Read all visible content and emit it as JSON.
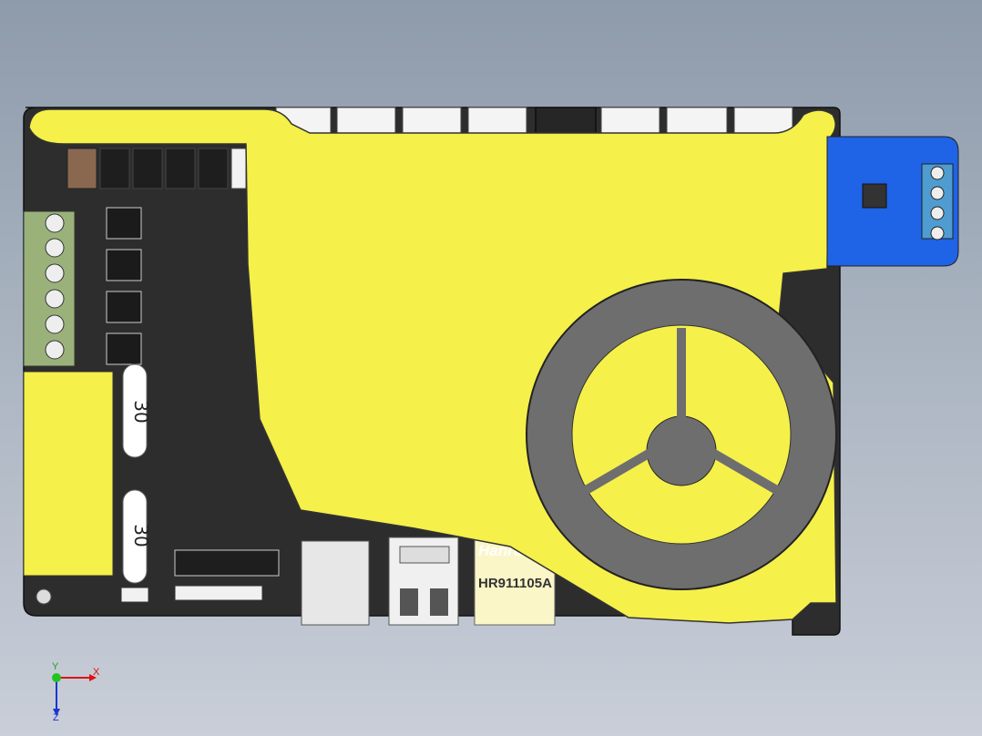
{
  "board": {
    "capacitor_label_top": "30",
    "capacitor_label_bottom": "30",
    "ethernet_jack_label": "HR911105A",
    "ethernet_jack_brand": "Hanrun"
  },
  "triad": {
    "x_label": "X",
    "y_label": "Y",
    "z_label": "Z"
  },
  "colors": {
    "background_top": "#8e9bab",
    "pcb": "#2d2d2d",
    "bracket_yellow": "#f5f04a",
    "sensor_blue": "#1f63e6",
    "fan_gray": "#6e6e6e",
    "terminal_green": "#9ab27a"
  }
}
